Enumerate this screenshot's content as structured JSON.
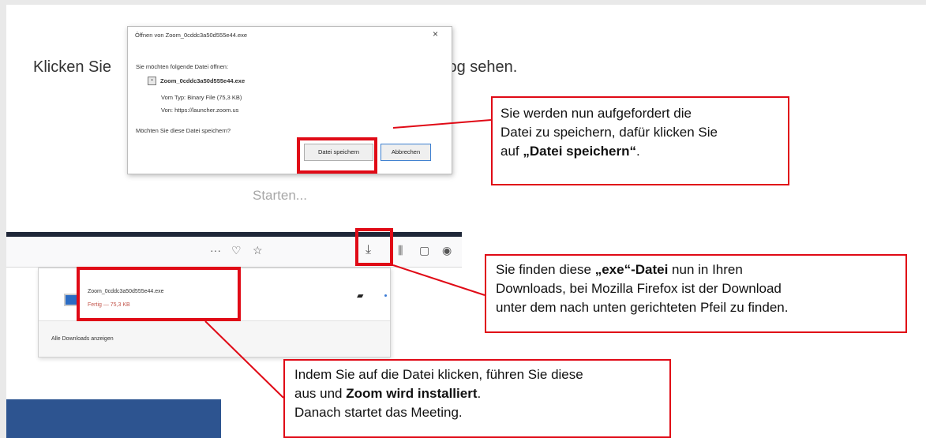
{
  "intro": {
    "text_start": "Klicken Sie",
    "text_end": "log sehen.",
    "starting": "Starten..."
  },
  "dialog": {
    "title": "Öffnen von Zoom_0cddc3a50d555e44.exe",
    "close_glyph": "×",
    "question": "Sie möchten folgende Datei öffnen:",
    "file_name": "Zoom_0cddc3a50d555e44.exe",
    "file_icon": "executable-file-icon",
    "type_line": "Vom Typ: Binary File (75,3 KB)",
    "from_line": "Von: https://launcher.zoom.us",
    "save_question": "Möchten Sie diese Datei speichern?",
    "save_button": "Datei speichern",
    "cancel_button": "Abbrechen"
  },
  "callout_1": {
    "line1": "Sie werden nun aufgefordert die",
    "line2": "Datei zu speichern, dafür klicken Sie",
    "line3_prefix": "auf ",
    "line3_bold": "„Datei speichern“",
    "line3_suffix": "."
  },
  "browser": {
    "toolbar_icons": [
      "more-icon",
      "pocket-icon",
      "star-icon",
      "download-arrow-icon",
      "library-icon",
      "sidebar-icon",
      "account-icon"
    ],
    "more_glyph": "···",
    "pocket_glyph": "♡",
    "star_glyph": "☆",
    "download_glyph": "⤓",
    "library_glyph": "⫼",
    "sidebar_glyph": "▢",
    "account_glyph": "◉"
  },
  "downloads": {
    "file_name": "Zoom_0cddc3a50d555e44.exe",
    "status": "Fertig — 75,3 KB",
    "folder_glyph": "▰",
    "show_all": "Alle Downloads anzeigen"
  },
  "callout_2": {
    "line1_prefix": "Sie finden diese ",
    "line1_bold": "„exe“-Datei",
    "line1_suffix": " nun in Ihren",
    "line2": "Downloads, bei Mozilla Firefox ist der Download",
    "line3": "unter dem nach unten gerichteten Pfeil zu finden."
  },
  "callout_3": {
    "line1": "Indem Sie auf die Datei klicken, führen Sie diese",
    "line2_prefix": "aus und ",
    "line2_bold": "Zoom wird installiert",
    "line2_suffix": ".",
    "line3": "Danach startet das Meeting."
  },
  "colors": {
    "highlight_red": "#e00a16",
    "firefox_dark": "#1f2738",
    "slide_blue": "#2d5490"
  }
}
